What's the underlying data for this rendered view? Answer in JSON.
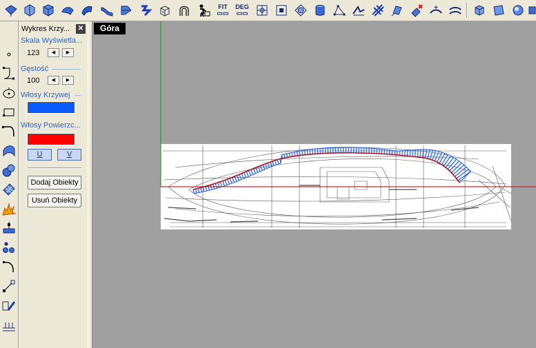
{
  "toolbar": {
    "buttons": [
      {
        "name": "blue-surface-icon"
      },
      {
        "name": "surface-edge-icon"
      },
      {
        "name": "surface-corner-icon"
      },
      {
        "name": "loft-icon"
      },
      {
        "name": "sweep-icon"
      },
      {
        "name": "blend-icon"
      },
      {
        "name": "patch-icon"
      },
      {
        "name": "network-surface-icon"
      },
      {
        "name": "extrude-icon"
      },
      {
        "name": "arch-icon"
      },
      {
        "name": "rail-person-icon"
      },
      {
        "name": "fit-button",
        "label": "FIT"
      },
      {
        "name": "deg-button",
        "label": "DEG"
      },
      {
        "name": "grid-cross-icon"
      },
      {
        "name": "grid-box-icon"
      },
      {
        "name": "gumball-icon"
      },
      {
        "name": "cylinder-icon"
      },
      {
        "name": "polygon-points-icon"
      },
      {
        "name": "fold-icon"
      },
      {
        "name": "lattice-icon"
      },
      {
        "name": "twist-icon"
      },
      {
        "name": "erase-point-icon"
      },
      {
        "name": "smooth-icon"
      },
      {
        "name": "flatten-icon"
      },
      {
        "name": "cube-icon"
      },
      {
        "name": "panel-icon"
      },
      {
        "name": "sphere-icon"
      },
      {
        "name": "material-icon"
      }
    ]
  },
  "panel": {
    "title": "Wykres Krzy...",
    "close_label": "✕",
    "scale_label": "Skala Wyświetla...",
    "scale_value": "123",
    "density_label": "Gęstość",
    "density_value": "100",
    "curve_hair_label": "Włosy Krzywej",
    "curve_hair_color": "#0a5bff",
    "surface_hair_label": "Włosy Powierzc...",
    "surface_hair_color": "#ff0000",
    "u_button": "U",
    "v_button": "V",
    "add_objects": "Dodaj Obiekty",
    "remove_objects": "Usuń Obiekty"
  },
  "viewport": {
    "label": "Góra",
    "background": "#a0a0a0",
    "x_axis_color": "#b03030",
    "y_axis_color": "#2a9a2a",
    "curve_color": "#b01020",
    "comb_color": "#1a5cf0"
  }
}
